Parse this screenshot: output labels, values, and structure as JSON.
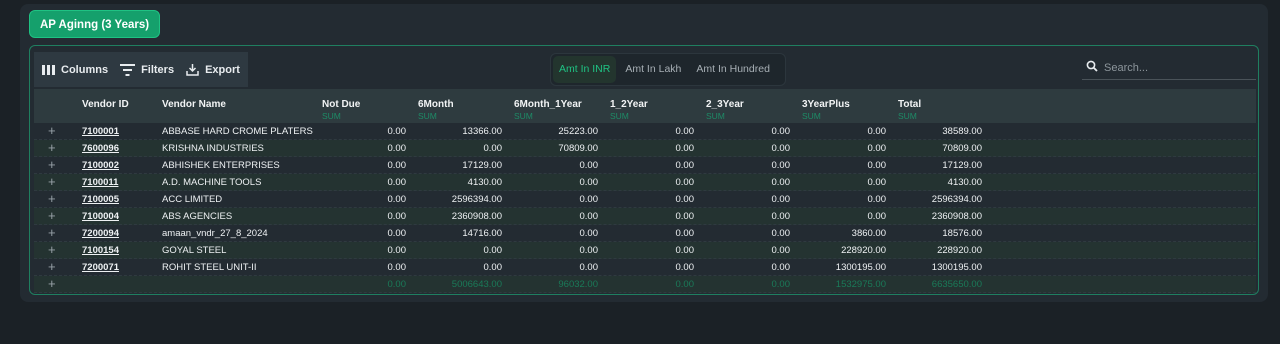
{
  "page_title": "AP Aginng (3 Years)",
  "toolbar": {
    "columns_label": "Columns",
    "filters_label": "Filters",
    "export_label": "Export"
  },
  "amount_toggle": {
    "options": [
      "Amt In INR",
      "Amt In Lakh",
      "Amt In Hundred"
    ],
    "selected": "Amt In INR"
  },
  "search": {
    "placeholder": "Search..."
  },
  "table": {
    "columns": [
      "Vendor ID",
      "Vendor Name",
      "Not Due",
      "6Month",
      "6Month_1Year",
      "1_2Year",
      "2_3Year",
      "3YearPlus",
      "Total"
    ],
    "sum_label": "SUM",
    "rows": [
      [
        "7100001",
        "ABBASE HARD CROME PLATERS",
        "0.00",
        "13366.00",
        "25223.00",
        "0.00",
        "0.00",
        "0.00",
        "38589.00"
      ],
      [
        "7600096",
        "KRISHNA INDUSTRIES",
        "0.00",
        "0.00",
        "70809.00",
        "0.00",
        "0.00",
        "0.00",
        "70809.00"
      ],
      [
        "7100002",
        "ABHISHEK ENTERPRISES",
        "0.00",
        "17129.00",
        "0.00",
        "0.00",
        "0.00",
        "0.00",
        "17129.00"
      ],
      [
        "7100011",
        "A.D. MACHINE TOOLS",
        "0.00",
        "4130.00",
        "0.00",
        "0.00",
        "0.00",
        "0.00",
        "4130.00"
      ],
      [
        "7100005",
        "ACC LIMITED",
        "0.00",
        "2596394.00",
        "0.00",
        "0.00",
        "0.00",
        "0.00",
        "2596394.00"
      ],
      [
        "7100004",
        "ABS AGENCIES",
        "0.00",
        "2360908.00",
        "0.00",
        "0.00",
        "0.00",
        "0.00",
        "2360908.00"
      ],
      [
        "7200094",
        "amaan_vndr_27_8_2024",
        "0.00",
        "14716.00",
        "0.00",
        "0.00",
        "0.00",
        "3860.00",
        "18576.00"
      ],
      [
        "7100154",
        "GOYAL STEEL",
        "0.00",
        "0.00",
        "0.00",
        "0.00",
        "0.00",
        "228920.00",
        "228920.00"
      ],
      [
        "7200071",
        "ROHIT STEEL UNIT-II",
        "0.00",
        "0.00",
        "0.00",
        "0.00",
        "0.00",
        "1300195.00",
        "1300195.00"
      ]
    ],
    "totals": [
      "0.00",
      "5006643.00",
      "96032.00",
      "0.00",
      "0.00",
      "1532975.00",
      "6635650.00"
    ]
  },
  "colors": {
    "accent": "#15a06c",
    "sum_text": "#1e8a66",
    "background": "#1b2126"
  }
}
